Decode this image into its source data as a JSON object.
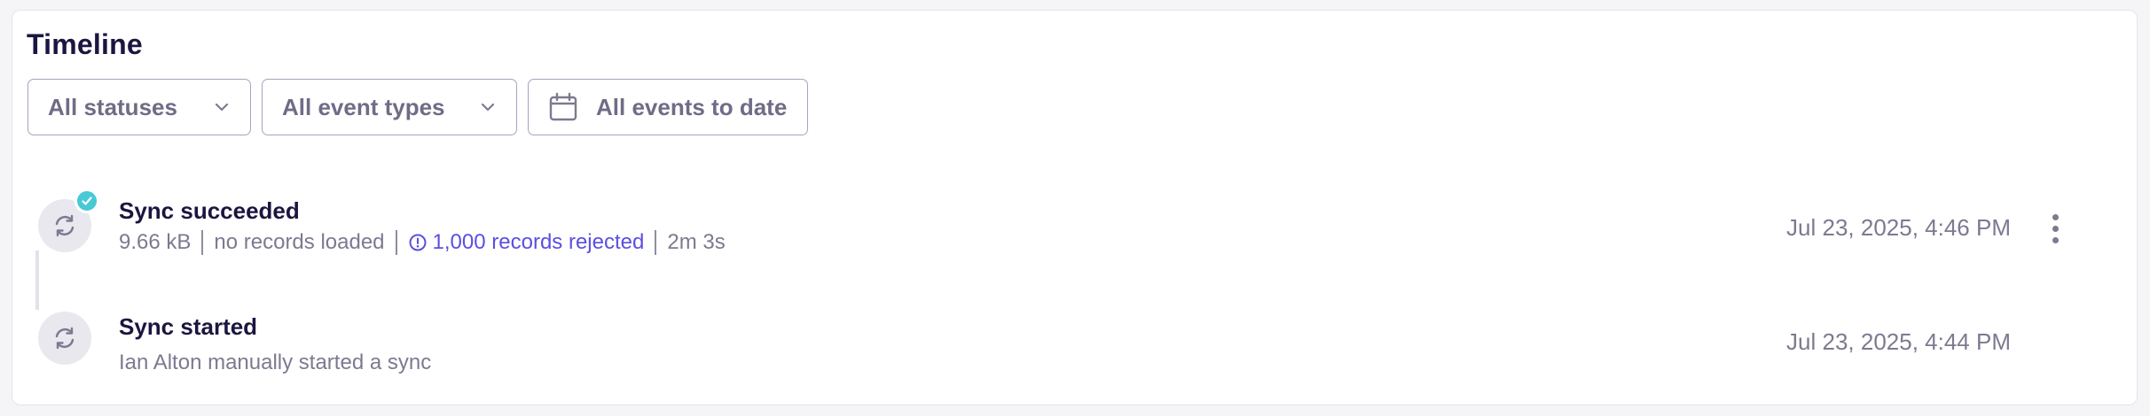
{
  "timeline": {
    "title": "Timeline",
    "filters": {
      "status": {
        "label": "All statuses",
        "icon": "chevron-down-icon"
      },
      "event_type": {
        "label": "All event types",
        "icon": "chevron-down-icon"
      },
      "date": {
        "label": "All events to date",
        "icon": "calendar-icon"
      }
    },
    "events": [
      {
        "title": "Sync succeeded",
        "size": "9.66 kB",
        "loaded": "no records loaded",
        "rejected": "1,000 records rejected",
        "duration": "2m 3s",
        "timestamp": "Jul 23, 2025, 4:46 PM",
        "status_icon": "check-icon",
        "status_color": "#48c9d6"
      },
      {
        "title": "Sync started",
        "description": "Ian Alton manually started a sync",
        "timestamp": "Jul 23, 2025, 4:44 PM"
      }
    ],
    "colors": {
      "accent": "#5b4fe0",
      "success": "#48c9d6",
      "title": "#1b1640",
      "muted": "#7c7a90"
    }
  }
}
